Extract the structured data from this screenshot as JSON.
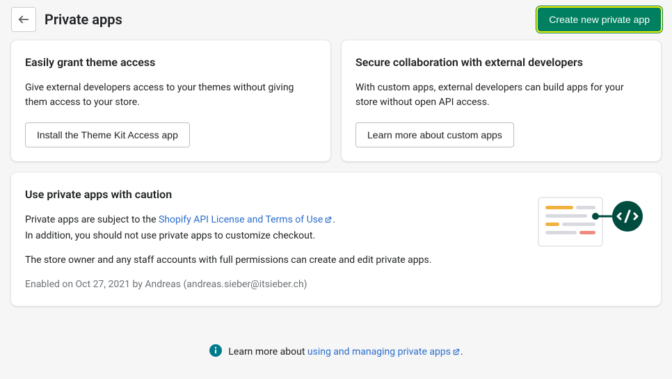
{
  "header": {
    "title": "Private apps",
    "create_button": "Create new private app"
  },
  "cards": {
    "theme": {
      "title": "Easily grant theme access",
      "body": "Give external developers access to your themes without giving them access to your store.",
      "button": "Install the Theme Kit Access app"
    },
    "collab": {
      "title": "Secure collaboration with external developers",
      "body": "With custom apps, external developers can build apps for your store without open API access.",
      "button": "Learn more about custom apps"
    }
  },
  "caution": {
    "title": "Use private apps with caution",
    "line1_prefix": "Private apps are subject to the ",
    "line1_link": "Shopify API License and Terms of Use",
    "line1_suffix": ".",
    "line2": "In addition, you should not use private apps to customize checkout.",
    "line3": "The store owner and any staff accounts with full permissions can create and edit private apps.",
    "meta": "Enabled on Oct 27, 2021 by Andreas (andreas.sieber@itsieber.ch)"
  },
  "footer": {
    "prefix": "Learn more about ",
    "link": "using and managing private apps",
    "suffix": "."
  }
}
